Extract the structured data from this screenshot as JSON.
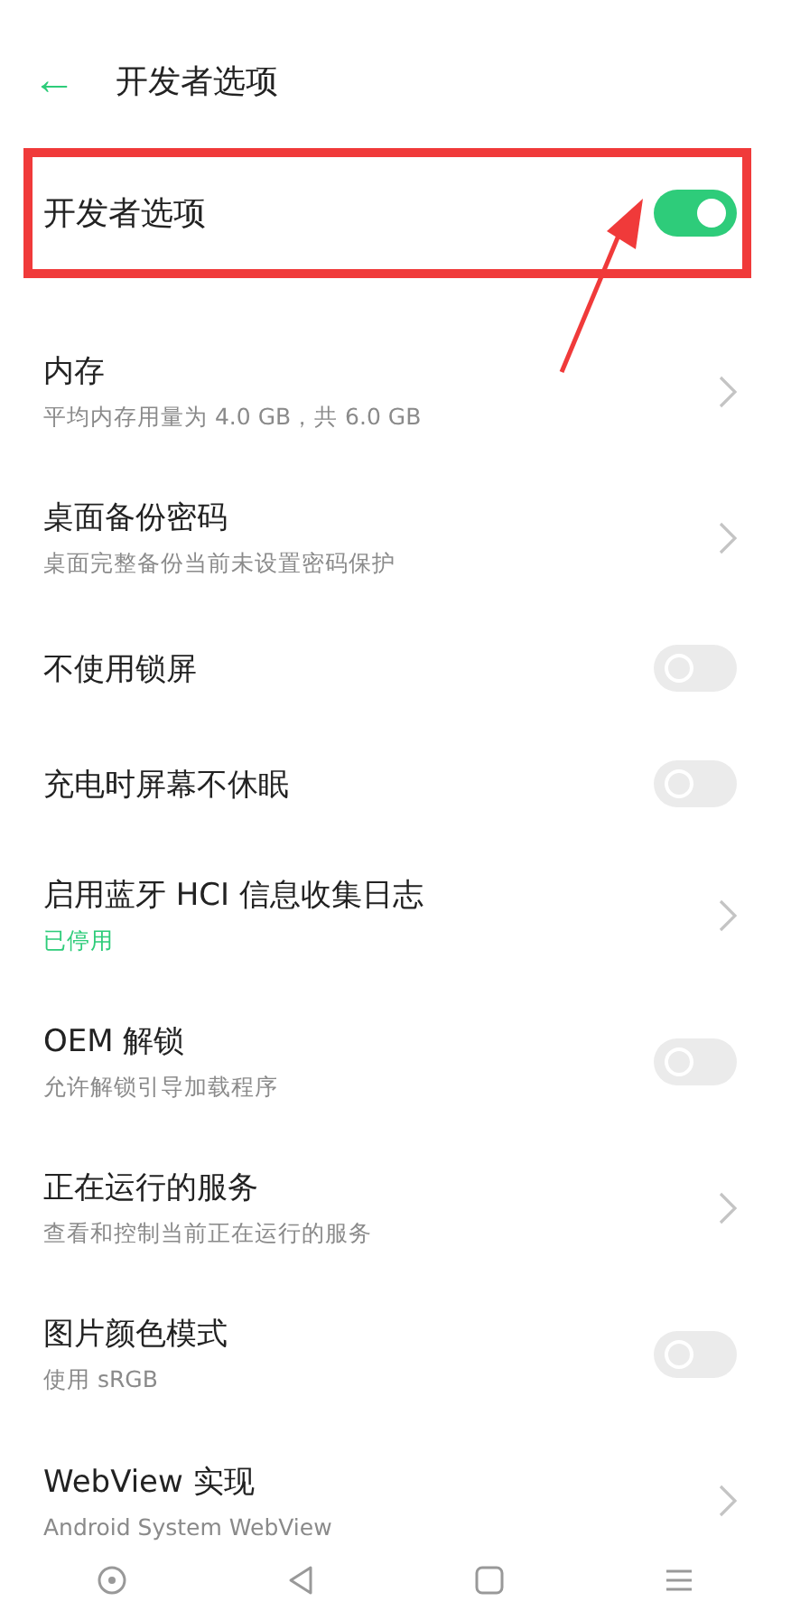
{
  "header": {
    "back": "←",
    "title": "开发者选项"
  },
  "master": {
    "label": "开发者选项",
    "on": true
  },
  "annotation": {
    "frame": true,
    "arrow": true
  },
  "items": [
    {
      "kind": "chevron",
      "title": "内存",
      "subtitle": "平均内存用量为 4.0 GB，共 6.0 GB",
      "sub_highlighted": false
    },
    {
      "kind": "chevron",
      "title": "桌面备份密码",
      "subtitle": "桌面完整备份当前未设置密码保护",
      "sub_highlighted": false
    },
    {
      "kind": "toggle",
      "title": "不使用锁屏",
      "on": false
    },
    {
      "kind": "toggle",
      "title": "充电时屏幕不休眠",
      "on": false
    },
    {
      "kind": "chevron",
      "title": "启用蓝牙 HCI 信息收集日志",
      "subtitle": "已停用",
      "sub_highlighted": true
    },
    {
      "kind": "toggle",
      "title": "OEM 解锁",
      "subtitle": "允许解锁引导加载程序",
      "sub_highlighted": false,
      "on": false
    },
    {
      "kind": "chevron",
      "title": "正在运行的服务",
      "subtitle": "查看和控制当前正在运行的服务",
      "sub_highlighted": false
    },
    {
      "kind": "toggle",
      "title": "图片颜色模式",
      "subtitle": "使用 sRGB",
      "sub_highlighted": false,
      "on": false
    },
    {
      "kind": "chevron",
      "title": "WebView 实现",
      "subtitle": "Android System WebView",
      "sub_highlighted": false
    }
  ]
}
